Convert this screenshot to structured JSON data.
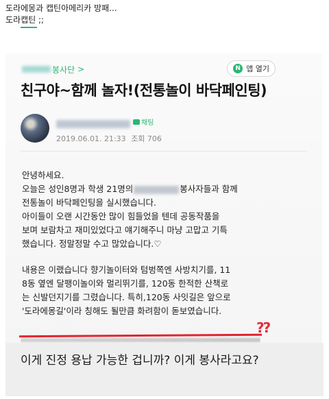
{
  "caption": {
    "line1": "도라에몽과 캡틴아메리카 방패...",
    "line2": "도라캡틴 ;;"
  },
  "post": {
    "cafe_name": "봉사단",
    "cafe_chevron": ">",
    "app_button_label": "앱 열기",
    "app_icon": "N",
    "title": "친구야~함께 놀자!(전통놀이 바닥페인팅)",
    "tag": "채팅",
    "date": "2019.06.01. 21:33",
    "views": "조회 706"
  },
  "body": {
    "p1_greeting": "안녕하세요.",
    "p1_line2a": "오늘은 성인8명과 학생 21명의",
    "p1_line2b": "봉사자들과 함께",
    "p1_rest": "전통놀이 바닥페인팅을 실시했습니다.",
    "p1_line4": "아이들이 오랜 시간동안 많이 힘들었을 텐데 공동작품을",
    "p1_line5": "보며 보람차고 재미있었다고 얘기해주니 마냥 고맙고 기특",
    "p1_line6": "했습니다. 정말정말 수고 많았습니다.♡",
    "p2_line1": "내용은 이랬습니다 향기놀이터와 텀벙쪽엔 사방치기를, 11",
    "p2_line2": "8동 옆엔 달팽이놀이와 멀리뛰기를, 120동 한적한 산책로",
    "p2_line3": "는 신발던지기를 그렸습니다. 특히,120동 사잇길은 앞으로",
    "p2_line4": "'도라에몽길'이라 칭해도 될만큼 화려함이 돋보였습니다."
  },
  "annotation": {
    "question_marks": "??",
    "mark_color": "#e0242f"
  },
  "comment": {
    "text": "이게 진정 용납 가능한 겁니까? 이게 봉사라고요?"
  },
  "colors": {
    "accent_green": "#2bb673",
    "background": "#ffffff",
    "comment_bg": "#eeeeee"
  }
}
